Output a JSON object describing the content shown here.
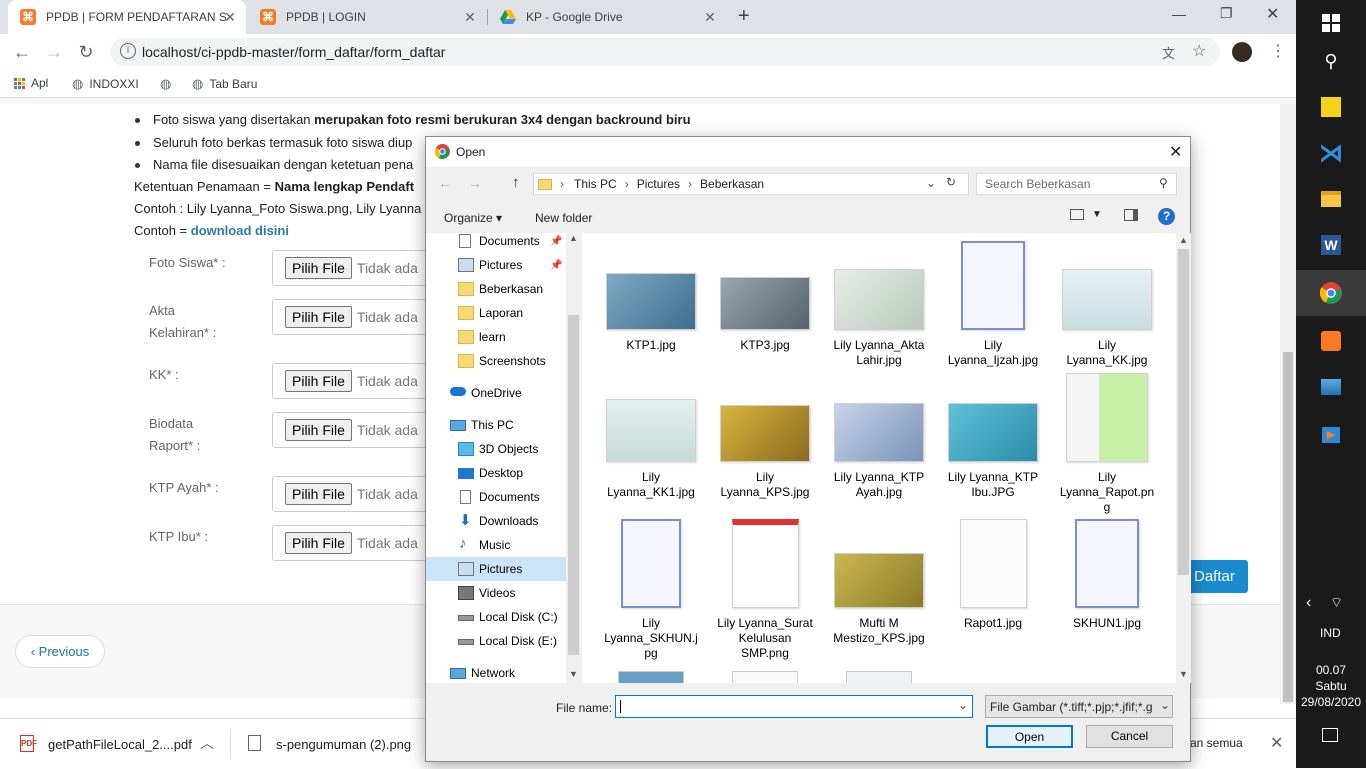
{
  "browser": {
    "tabs": [
      {
        "title": "PPDB | FORM PENDAFTARAN SMP"
      },
      {
        "title": "PPDB | LOGIN"
      },
      {
        "title": "KP - Google Drive"
      }
    ],
    "url": "localhost/ci-ppdb-master/form_daftar/form_daftar",
    "bookmarks": [
      "Apl",
      "INDOXXI",
      "Tab Baru"
    ]
  },
  "page": {
    "bullets": [
      "Foto siswa yang disertakan",
      "merupakan foto resmi berukuran 3x4 dengan backround biru",
      "Seluruh foto berkas termasuk foto siswa diup",
      "Nama file disesuaikan dengan ketetuan pena"
    ],
    "naming_prefix": "Ketentuan Penamaan =",
    "naming_bold": "Nama lengkap Pendaft",
    "example_text": "Contoh : Lily Lyanna_Foto Siswa.png, Lily Lyanna",
    "example2_prefix": "Contoh =",
    "download_link": "download disini",
    "fields": [
      {
        "label1": "Foto Siswa* :",
        "label2": ""
      },
      {
        "label1": "Akta",
        "label2": "Kelahiran* :"
      },
      {
        "label1": "KK* :",
        "label2": ""
      },
      {
        "label1": "Biodata",
        "label2": "Raport* :"
      },
      {
        "label1": "KTP Ayah* :",
        "label2": ""
      },
      {
        "label1": "KTP Ibu* :",
        "label2": ""
      }
    ],
    "choose_file": "Pilih File",
    "no_file": "Tidak ada",
    "submit": "Daftar",
    "previous": "‹ Previous"
  },
  "downloads": {
    "items": [
      "getPathFileLocal_2....pdf",
      "s-pengumuman (2).png"
    ],
    "show_all": "an semua"
  },
  "dialog": {
    "title": "Open",
    "path": [
      "This PC",
      "Pictures",
      "Beberkasan"
    ],
    "search_placeholder": "Search Beberkasan",
    "organize": "Organize",
    "new_folder": "New folder",
    "nav_items": [
      "Documents",
      "Pictures",
      "Beberkasan",
      "Laporan",
      "learn",
      "Screenshots",
      "OneDrive",
      "This PC",
      "3D Objects",
      "Desktop",
      "Documents",
      "Downloads",
      "Music",
      "Pictures",
      "Videos",
      "Local Disk (C:)",
      "Local Disk (E:)",
      "Network"
    ],
    "files": [
      {
        "l1": "KTP1.jpg",
        "l2": "",
        "l3": ""
      },
      {
        "l1": "KTP3.jpg",
        "l2": "",
        "l3": ""
      },
      {
        "l1": "Lily Lyanna_Akta",
        "l2": "Lahir.jpg",
        "l3": ""
      },
      {
        "l1": "Lily",
        "l2": "Lyanna_Ijzah.jpg",
        "l3": ""
      },
      {
        "l1": "Lily",
        "l2": "Lyanna_KK.jpg",
        "l3": ""
      },
      {
        "l1": "Lily",
        "l2": "Lyanna_KK1.jpg",
        "l3": ""
      },
      {
        "l1": "Lily",
        "l2": "Lyanna_KPS.jpg",
        "l3": ""
      },
      {
        "l1": "Lily Lyanna_KTP",
        "l2": "Ayah.jpg",
        "l3": ""
      },
      {
        "l1": "Lily Lyanna_KTP",
        "l2": "Ibu.JPG",
        "l3": ""
      },
      {
        "l1": "Lily",
        "l2": "Lyanna_Rapot.pn",
        "l3": "g"
      },
      {
        "l1": "Lily",
        "l2": "Lyanna_SKHUN.j",
        "l3": "pg"
      },
      {
        "l1": "Lily Lyanna_Surat",
        "l2": "Kelulusan",
        "l3": "SMP.png"
      },
      {
        "l1": "Mufti M",
        "l2": "Mestizo_KPS.jpg",
        "l3": ""
      },
      {
        "l1": "Rapot1.jpg",
        "l2": "",
        "l3": ""
      },
      {
        "l1": "SKHUN1.jpg",
        "l2": "",
        "l3": ""
      }
    ],
    "file_name_label": "File name:",
    "file_name_value": "",
    "file_type": "File Gambar (*.tiff;*.pjp;*.jfif;*.g",
    "open_button": "Open",
    "cancel_button": "Cancel"
  },
  "taskbar": {
    "lang": "IND",
    "time": "00.07",
    "day": "Sabtu",
    "date": "29/08/2020"
  }
}
